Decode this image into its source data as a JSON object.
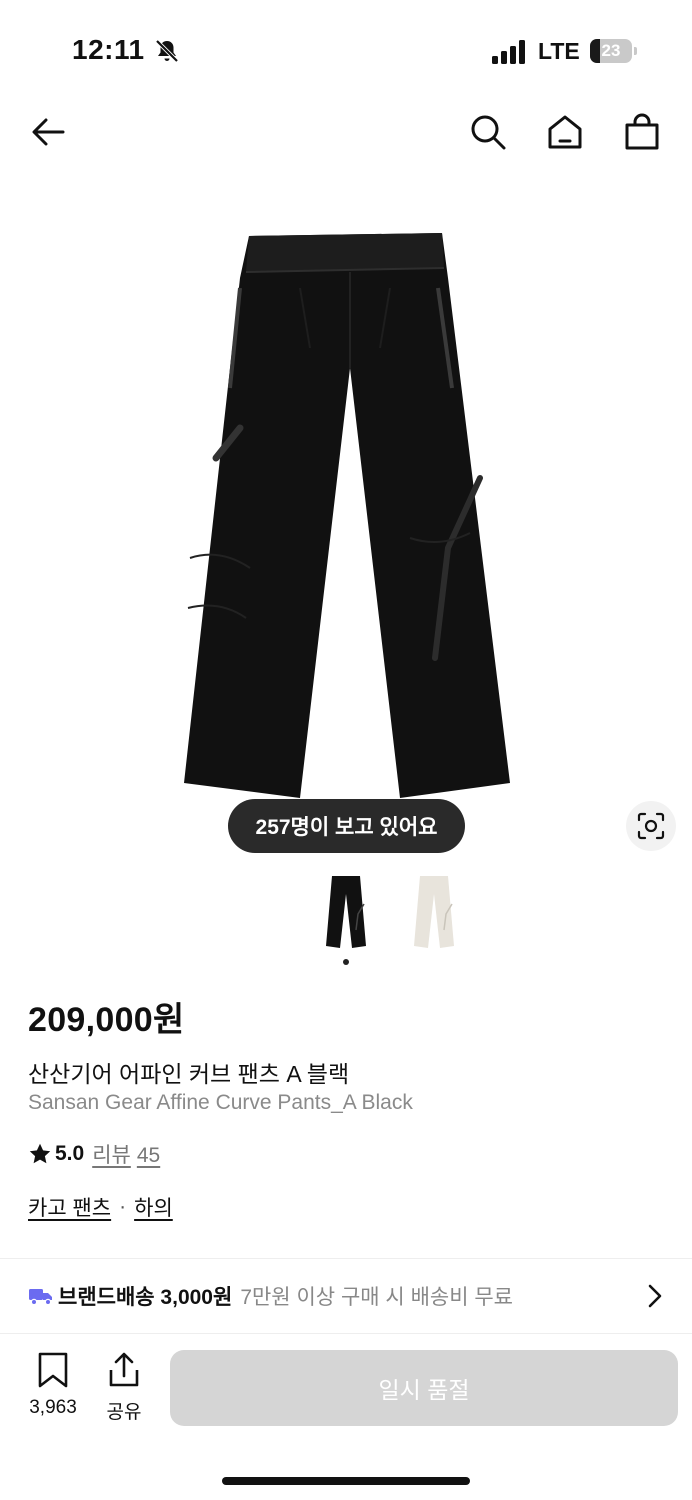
{
  "status_bar": {
    "time": "12:11",
    "network": "LTE",
    "battery": "23",
    "battery_level": 0.23,
    "icons": [
      "bell-slash-icon",
      "signal-icon"
    ]
  },
  "nav": {
    "icons": [
      "back-arrow-icon",
      "search-icon",
      "home-icon",
      "shopping-bag-icon"
    ]
  },
  "product": {
    "image_icon": "black-cargo-pants-image",
    "viewers_badge": "257명이 보고 있어요",
    "thumbnails": [
      "black-pants-thumbnail",
      "ivory-pants-thumbnail"
    ],
    "price": "209,000원",
    "name_ko": "산산기어 어파인 커브 팬츠 A 블랙",
    "name_en": "Sansan Gear Affine Curve Pants_A Black",
    "rating": "5.0",
    "review_label": "리뷰",
    "review_count": "45",
    "categories": [
      "카고 팬츠",
      "하의"
    ],
    "category_separator": "·"
  },
  "shipping": {
    "title": "브랜드배송 3,000원",
    "description": "7만원 이상 구매 시 배송비 무료"
  },
  "bottom_bar": {
    "bookmark_count": "3,963",
    "share_label": "공유",
    "primary_button": "일시 품절"
  },
  "colors": {
    "pill_bg": "#2a2a2a",
    "disabled_button": "#d5d5d5",
    "truck_accent": "#6b6bf0",
    "secondary_text": "#8a8a8a"
  }
}
